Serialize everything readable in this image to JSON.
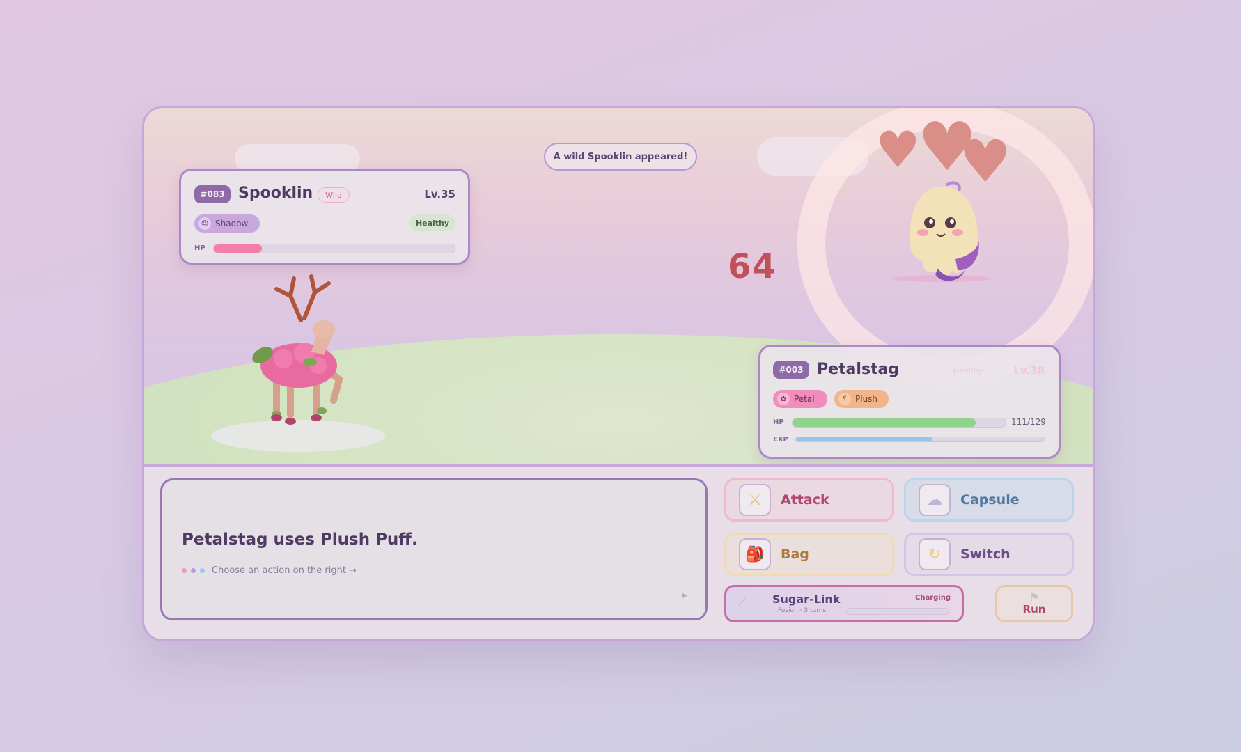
{
  "announcement": "A wild Spooklin appeared!",
  "damage_popup": "64",
  "enemy": {
    "number": "#083",
    "name": "Spooklin",
    "tag": "Wild",
    "level": "Lv.35",
    "type": "Shadow",
    "type_icon": "ghost-face-icon",
    "status": "Healthy",
    "hp_label": "HP",
    "hp_fraction": 0.2,
    "colors": {
      "hp": "#f27fa8",
      "type_chip": "#c9a8dd"
    }
  },
  "player": {
    "number": "#003",
    "name": "Petalstag",
    "status": "Healthy",
    "level": "Lv.38",
    "types": [
      {
        "label": "Petal",
        "icon": "flower-icon",
        "color": "#ef8ebc"
      },
      {
        "label": "Plush",
        "icon": "bear-face-icon",
        "color": "#f2b48a"
      }
    ],
    "hp_label": "HP",
    "hp_text": "111/129",
    "hp_fraction": 0.86,
    "exp_label": "EXP",
    "exp_fraction": 0.55,
    "colors": {
      "hp": "#8fd48a",
      "exp": "#98c6e6"
    }
  },
  "dialog": {
    "message": "Petalstag uses Plush Puff.",
    "hint": "Choose an action on the right →",
    "next_icon": "play-triangle-icon"
  },
  "actions": {
    "attack": {
      "label": "Attack",
      "icon": "crossed-swords-icon",
      "color": "#b5446c"
    },
    "capsule": {
      "label": "Capsule",
      "icon": "cloud-capsule-icon",
      "color": "#4f7a9e"
    },
    "bag": {
      "label": "Bag",
      "icon": "backpack-icon",
      "color": "#b07a3c"
    },
    "switch": {
      "label": "Switch",
      "icon": "swap-ring-icon",
      "color": "#6e4d8a"
    }
  },
  "sugar_link": {
    "label": "Sugar-Link",
    "subtitle": "Fusion · 3 turns",
    "status": "Charging",
    "progress_fraction": 0.0,
    "icon": "wand-icon"
  },
  "run": {
    "label": "Run",
    "icon": "flag-icon"
  }
}
